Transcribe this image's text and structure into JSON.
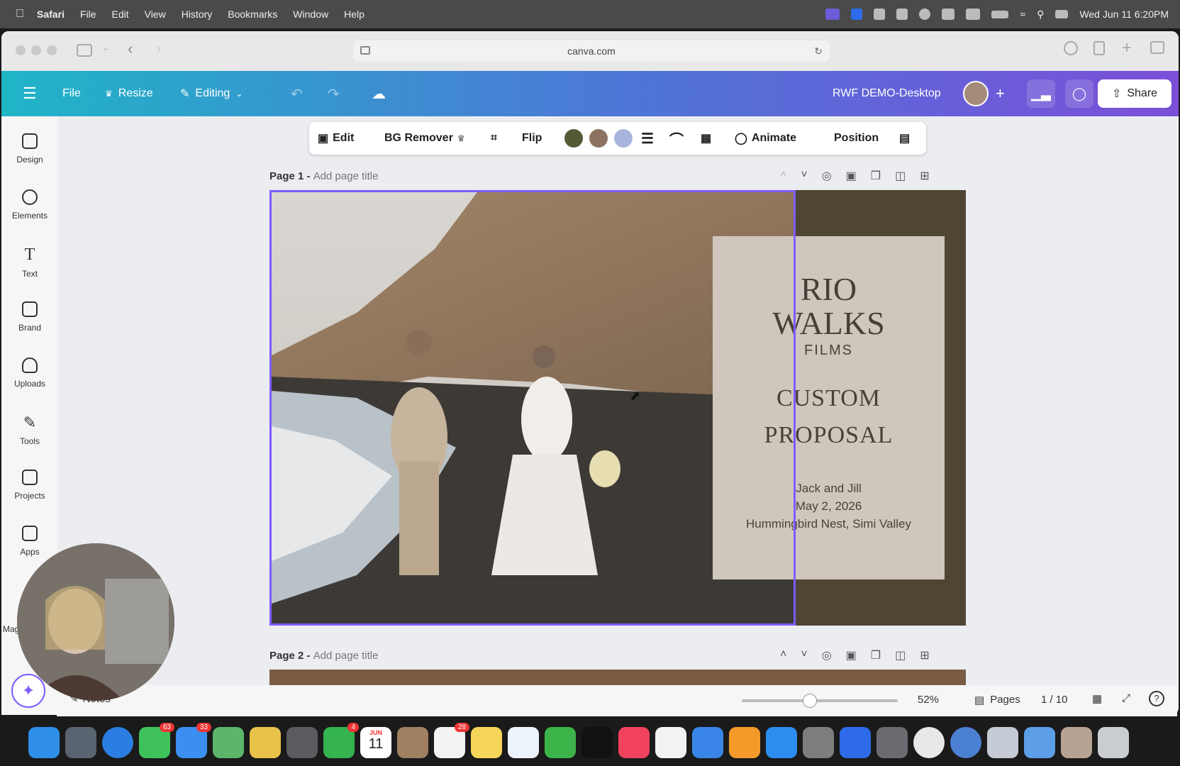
{
  "menubar": {
    "app_name": "Safari",
    "items": [
      "File",
      "Edit",
      "View",
      "History",
      "Bookmarks",
      "Window",
      "Help"
    ],
    "clock": "Wed Jun 11  6:20PM"
  },
  "browser": {
    "url": "canva.com"
  },
  "canva_header": {
    "file_label": "File",
    "resize_label": "Resize",
    "editing_label": "Editing",
    "doc_title": "RWF DEMO-Desktop",
    "share_label": "Share"
  },
  "sidebar": {
    "items": [
      {
        "label": "Design",
        "icon": "design-icon"
      },
      {
        "label": "Elements",
        "icon": "elements-icon"
      },
      {
        "label": "Text",
        "icon": "text-icon"
      },
      {
        "label": "Brand",
        "icon": "brand-icon"
      },
      {
        "label": "Uploads",
        "icon": "uploads-icon"
      },
      {
        "label": "Tools",
        "icon": "tools-icon"
      },
      {
        "label": "Projects",
        "icon": "projects-icon"
      },
      {
        "label": "Apps",
        "icon": "apps-icon"
      },
      {
        "label": "Mag",
        "icon": "magic-icon"
      }
    ]
  },
  "toolbar": {
    "edit_label": "Edit",
    "bg_remover_label": "BG Remover",
    "flip_label": "Flip",
    "animate_label": "Animate",
    "position_label": "Position",
    "swatches": [
      "#555a34",
      "#8c7260",
      "#a9b4dc"
    ]
  },
  "pages": [
    {
      "prefix": "Page 1 - ",
      "title_placeholder": "Add page title"
    },
    {
      "prefix": "Page 2 - ",
      "title_placeholder": "Add page title"
    }
  ],
  "card": {
    "brand_line1": "RIO",
    "brand_line2": "WALKS",
    "brand_line3": "FILMS",
    "headline_line1": "CUSTOM",
    "headline_line2": "PROPOSAL",
    "couple": "Jack and Jill",
    "date": "May 2, 2026",
    "venue": "Hummingbird Nest, Simi Valley"
  },
  "status": {
    "notes_label": "Notes",
    "zoom": "52%",
    "pages_label": "Pages",
    "page_counter": "1 / 10"
  },
  "dock": {
    "badges": {
      "messages": "63",
      "mail": "33",
      "facetime": "4",
      "reminders": "28"
    },
    "calendar_month": "JUN",
    "calendar_day": "11"
  }
}
